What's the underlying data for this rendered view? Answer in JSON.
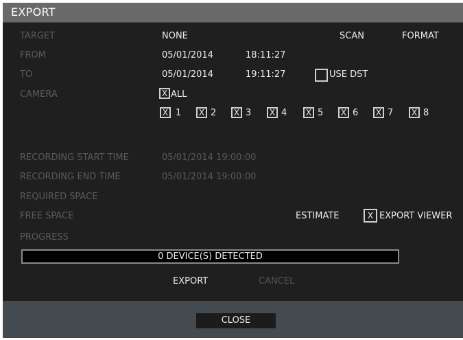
{
  "window": {
    "title": "EXPORT"
  },
  "fields": {
    "target": {
      "label": "TARGET",
      "value": "NONE"
    },
    "from": {
      "label": "FROM",
      "date": "05/01/2014",
      "time": "18:11:27"
    },
    "to": {
      "label": "TO",
      "date": "05/01/2014",
      "time": "19:11:27"
    },
    "use_dst": {
      "label": "USE DST",
      "mark": ""
    },
    "camera": {
      "label": "CAMERA",
      "all_label": "ALL",
      "all_mark": "X",
      "channels": [
        {
          "num": "1",
          "mark": "X"
        },
        {
          "num": "2",
          "mark": "X"
        },
        {
          "num": "3",
          "mark": "X"
        },
        {
          "num": "4",
          "mark": "X"
        },
        {
          "num": "5",
          "mark": "X"
        },
        {
          "num": "6",
          "mark": "X"
        },
        {
          "num": "7",
          "mark": "X"
        },
        {
          "num": "8",
          "mark": "X"
        }
      ]
    },
    "recording_start": {
      "label": "RECORDING START TIME",
      "value": "05/01/2014 19:00:00"
    },
    "recording_end": {
      "label": "RECORDING END TIME",
      "value": "05/01/2014 19:00:00"
    },
    "required_space": {
      "label": "REQUIRED SPACE"
    },
    "free_space": {
      "label": "FREE SPACE"
    },
    "progress": {
      "label": "PROGRESS",
      "text": "0 DEVICE(S) DETECTED"
    },
    "export_viewer": {
      "label": "EXPORT VIEWER",
      "mark": "X"
    }
  },
  "buttons": {
    "scan": "SCAN",
    "format": "FORMAT",
    "estimate": "ESTIMATE",
    "export": "EXPORT",
    "cancel": "CANCEL",
    "close": "CLOSE"
  }
}
